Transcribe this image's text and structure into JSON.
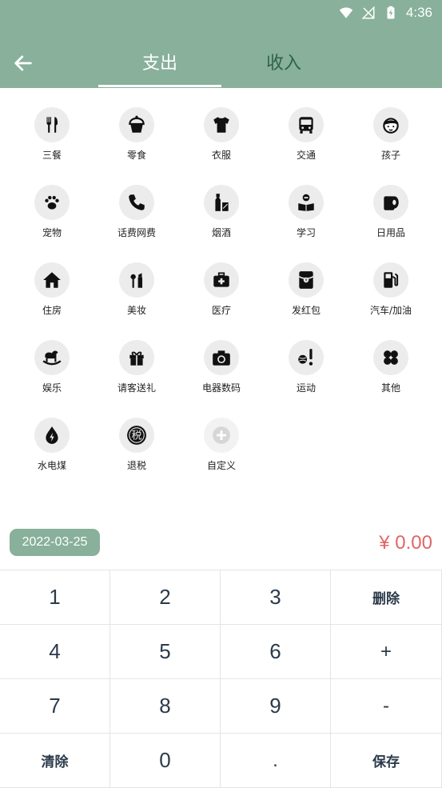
{
  "status_bar": {
    "time": "4:36"
  },
  "tabs": [
    {
      "label": "支出",
      "active": true
    },
    {
      "label": "收入",
      "active": false
    }
  ],
  "categories": [
    {
      "label": "三餐",
      "icon": "utensils-icon"
    },
    {
      "label": "零食",
      "icon": "cupcake-icon"
    },
    {
      "label": "衣服",
      "icon": "tshirt-icon"
    },
    {
      "label": "交通",
      "icon": "bus-icon"
    },
    {
      "label": "孩子",
      "icon": "child-face-icon"
    },
    {
      "label": "宠物",
      "icon": "paw-icon"
    },
    {
      "label": "话费网费",
      "icon": "phone-icon"
    },
    {
      "label": "烟酒",
      "icon": "bottle-icon"
    },
    {
      "label": "学习",
      "icon": "reading-icon"
    },
    {
      "label": "日用品",
      "icon": "tissue-roll-icon"
    },
    {
      "label": "住房",
      "icon": "house-icon"
    },
    {
      "label": "美妆",
      "icon": "makeup-icon"
    },
    {
      "label": "医疗",
      "icon": "medical-kit-icon"
    },
    {
      "label": "发红包",
      "icon": "red-envelope-icon"
    },
    {
      "label": "汽车/加油",
      "icon": "gas-pump-icon"
    },
    {
      "label": "娱乐",
      "icon": "rocking-horse-icon"
    },
    {
      "label": "请客送礼",
      "icon": "gift-icon"
    },
    {
      "label": "电器数码",
      "icon": "camera-icon"
    },
    {
      "label": "运动",
      "icon": "sports-icon"
    },
    {
      "label": "其他",
      "icon": "clover-icon"
    },
    {
      "label": "水电煤",
      "icon": "utility-drop-icon"
    },
    {
      "label": "退税",
      "icon": "tax-icon",
      "glyph": "税"
    },
    {
      "label": "自定义",
      "icon": "add-icon"
    }
  ],
  "date": "2022-03-25",
  "amount": "¥ 0.00",
  "keys": [
    "1",
    "2",
    "3",
    "删除",
    "4",
    "5",
    "6",
    "+",
    "7",
    "8",
    "9",
    "-",
    "清除",
    "0",
    ".",
    "保存"
  ],
  "colors": {
    "header": "#88b09b",
    "amount": "#e06666",
    "tab_inactive": "#2f6348"
  }
}
